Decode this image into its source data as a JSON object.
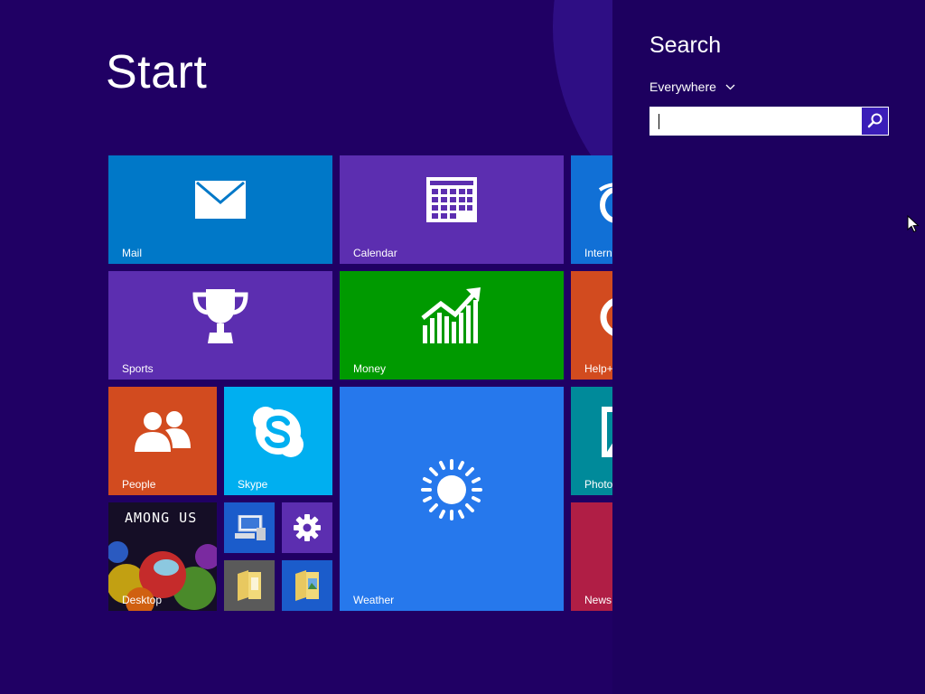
{
  "start": {
    "title": "Start"
  },
  "tiles": {
    "mail": "Mail",
    "calendar": "Calendar",
    "internet_explorer": "Intern",
    "sports": "Sports",
    "money": "Money",
    "help_tips": "Help+",
    "people": "People",
    "skype": "Skype",
    "weather": "Weather",
    "photos": "Photo",
    "desktop": "Desktop",
    "news": "News",
    "desktop_art_text": "AMONG US"
  },
  "search_charm": {
    "title": "Search",
    "scope": "Everywhere",
    "query": "",
    "placeholder": ""
  },
  "icons": {
    "mail": "envelope-icon",
    "calendar": "calendar-icon",
    "internet_explorer": "internet-explorer-icon",
    "sports": "trophy-icon",
    "money": "chart-growth-icon",
    "help_tips": "lifebuoy-icon",
    "people": "people-icon",
    "skype": "skype-icon",
    "weather": "sun-icon",
    "photos": "photo-icon",
    "computer": "computer-icon",
    "pc_settings": "gear-icon",
    "file_explorer": "folder-icon",
    "photo_viewer": "folder-picture-icon",
    "search": "magnifier-icon",
    "cursor": "mouse-pointer-icon"
  },
  "colors": {
    "background": "#200064",
    "charm_background": "#1d005f",
    "mail": "#0078c8",
    "calendar": "#5c2eb0",
    "internet_explorer": "#1170d6",
    "sports": "#5c2eb0",
    "money": "#009a00",
    "help_tips": "#d24b1f",
    "people": "#d24b1f",
    "skype": "#00aff0",
    "weather": "#2678ec",
    "photos": "#008a9a",
    "news": "#b01e45",
    "search_button": "#3a1db8"
  }
}
